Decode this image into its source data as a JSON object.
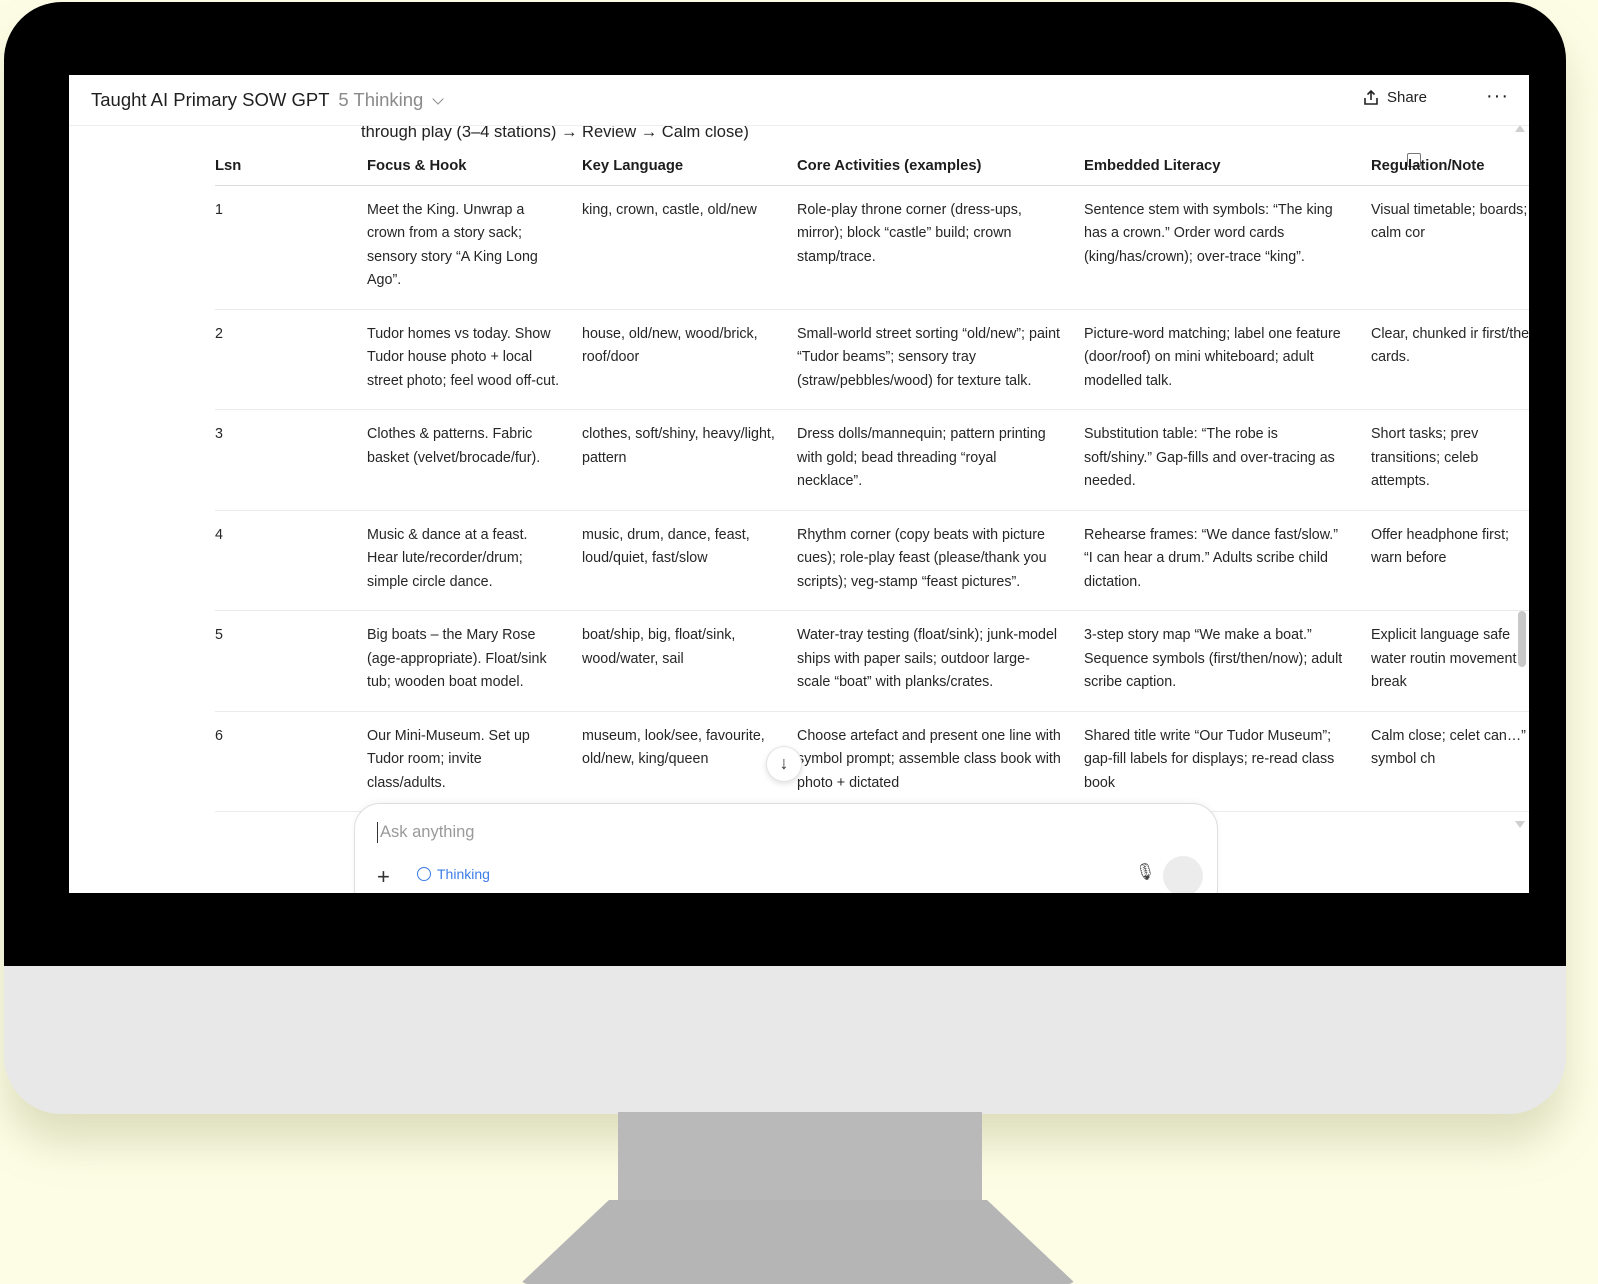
{
  "app": {
    "title": "Taught AI Primary SOW GPT",
    "model": "5 Thinking",
    "share_label": "Share",
    "more_label": "···"
  },
  "intro_line": "through play (3–4 stations) → Review → Calm close)",
  "table": {
    "headers": [
      "Lsn",
      "Focus & Hook",
      "Key Language",
      "Core Activities (examples)",
      "Embedded Literacy",
      "Regulation/Note"
    ],
    "rows": [
      {
        "lsn": "1",
        "focus": "Meet the King. Unwrap a crown from a story sack; sensory story “A King Long Ago”.",
        "language": "king, crown, castle, old/new",
        "activities": "Role-play throne corner (dress-ups, mirror); block “castle” build; crown stamp/trace.",
        "literacy": "Sentence stem with symbols: “The king has a crown.” Order word cards (king/has/crown); over-trace “king”.",
        "regulation": "Visual timetable; boards; calm cor"
      },
      {
        "lsn": "2",
        "focus": "Tudor homes vs today. Show Tudor house photo + local street photo; feel wood off-cut.",
        "language": "house, old/new, wood/brick, roof/door",
        "activities": "Small-world street sorting “old/new”; paint “Tudor beams”; sensory tray (straw/pebbles/wood) for texture talk.",
        "literacy": "Picture-word matching; label one feature (door/roof) on mini whiteboard; adult modelled talk.",
        "regulation": "Clear, chunked ir first/then cards."
      },
      {
        "lsn": "3",
        "focus": "Clothes & patterns. Fabric basket (velvet/brocade/fur).",
        "language": "clothes, soft/shiny, heavy/light, pattern",
        "activities": "Dress dolls/mannequin; pattern printing with gold; bead threading “royal necklace”.",
        "literacy": "Substitution table: “The robe is soft/shiny.” Gap-fills and over-tracing as needed.",
        "regulation": "Short tasks; prev transitions; celeb attempts."
      },
      {
        "lsn": "4",
        "focus": "Music & dance at a feast. Hear lute/recorder/drum; simple circle dance.",
        "language": "music, drum, dance, feast, loud/quiet, fast/slow",
        "activities": "Rhythm corner (copy beats with picture cues); role-play feast (please/thank you scripts); veg-stamp “feast pictures”.",
        "literacy": "Rehearse frames: “We dance fast/slow.” “I can hear a drum.” Adults scribe child dictation.",
        "regulation": "Offer headphone first; warn before"
      },
      {
        "lsn": "5",
        "focus": "Big boats – the Mary Rose (age-appropriate). Float/sink tub; wooden boat model.",
        "language": "boat/ship, big, float/sink, wood/water, sail",
        "activities": "Water-tray testing (float/sink); junk-model ships with paper sails; outdoor large-scale “boat” with planks/crates.",
        "literacy": "3-step story map “We make a boat.” Sequence symbols (first/then/now); adult scribe caption.",
        "regulation": "Explicit language safe water routin movement break"
      },
      {
        "lsn": "6",
        "focus": "Our Mini-Museum. Set up Tudor room; invite class/adults.",
        "language": "museum, look/see, favourite, old/new, king/queen",
        "activities": "Choose artefact and present one line with symbol prompt; assemble class book with photo + dictated",
        "literacy": "Shared title write “Our Tudor Museum”; gap-fill labels for displays; re-read class book",
        "regulation": "Calm close; celet can…” symbol ch"
      }
    ]
  },
  "composer": {
    "placeholder": "Ask anything",
    "plus_label": "+",
    "mode_label": "Thinking",
    "mic_label": "🎙"
  },
  "colors": {
    "background": "#fdfde6",
    "bezel": "#000000",
    "chin": "#e8e8e8",
    "stand": "#b9b9b9",
    "accent_blue": "#3d7de8"
  },
  "icons": [
    "share-icon",
    "more-icon",
    "chevron-down-icon",
    "copy-icon",
    "arrow-down-icon",
    "plus-icon",
    "clock-icon",
    "mic-icon",
    "voice-icon"
  ]
}
